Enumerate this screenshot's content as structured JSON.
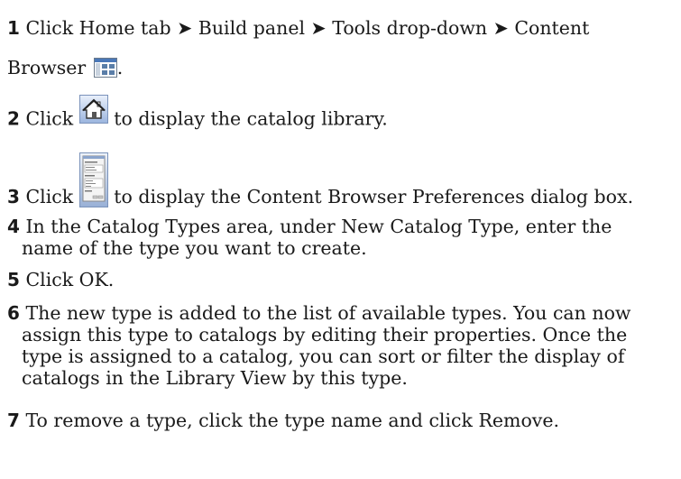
{
  "steps": [
    {
      "num": "1",
      "text_a": "Click Home tab ➤ Build panel ➤ Tools drop-down ➤ Content",
      "text_b": "Browser",
      "text_c": "."
    },
    {
      "num": "2",
      "text_a": "Click",
      "text_b": "to display the catalog library."
    },
    {
      "num": "3",
      "text_a": "Click",
      "text_b": "to display the Content Browser Preferences dialog box."
    },
    {
      "num": "4",
      "text_a": "In the Catalog Types area, under New Catalog Type, enter the",
      "text_b": "name of the type you want to create."
    },
    {
      "num": "5",
      "text_a": "Click OK."
    },
    {
      "num": "6",
      "text_a": "The new type is added to the list of available types. You can now",
      "text_b": "assign this type to catalogs by editing their properties. Once the",
      "text_c": "type is assigned to a catalog, you can sort or filter the display of",
      "text_d": "catalogs in the Library View by this type."
    },
    {
      "num": "7",
      "text_a": "To remove a type, click the type name and click Remove."
    }
  ],
  "icons": {
    "content_browser": "content-browser-icon",
    "home": "home-icon",
    "preferences": "preferences-dialog-icon"
  }
}
